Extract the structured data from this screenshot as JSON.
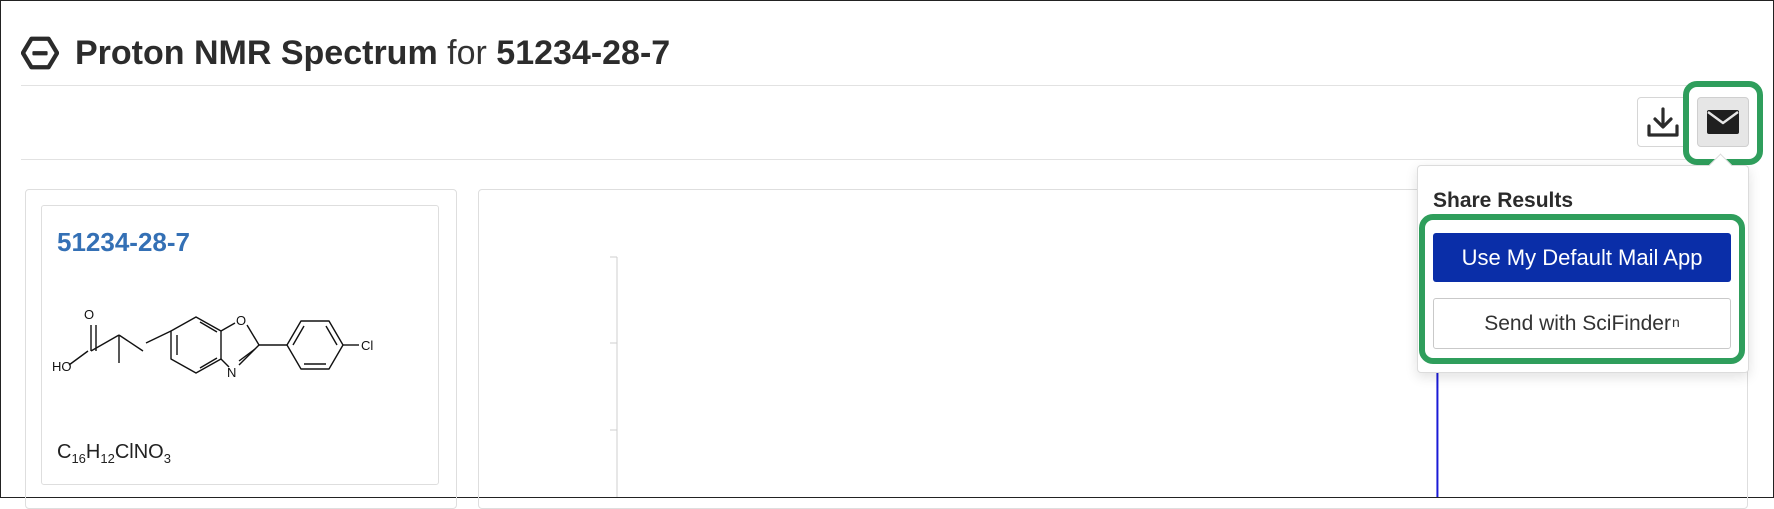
{
  "header": {
    "title_main": "Proton NMR Spectrum",
    "title_for": "for",
    "title_cas": "51234-28-7"
  },
  "toolbar": {
    "download_icon": "download-icon",
    "mail_icon": "envelope-icon"
  },
  "substance": {
    "cas_number": "51234-28-7",
    "formula_c": "C",
    "formula_c_count": "16",
    "formula_h": "H",
    "formula_h_count": "12",
    "formula_rest": "ClNO",
    "formula_o_count": "3",
    "structure_labels": {
      "oxygen_carbonyl": "O",
      "hydroxyl": "HO",
      "ring_oxygen": "O",
      "ring_nitrogen": "N",
      "chlorine": "Cl"
    }
  },
  "share_popover": {
    "title": "Share Results",
    "default_mail_label": "Use My Default Mail App",
    "scifinder_label": "Send with SciFinder",
    "scifinder_superscript": "n"
  },
  "colors": {
    "primary_button": "#0a2ea8",
    "link": "#3470b5",
    "highlight": "#2f9e5c",
    "spectrum_line": "#1a1ad6"
  },
  "spectrum": {
    "peaks": [
      {
        "position_fraction": 0.78,
        "intensity": 0.82
      }
    ]
  }
}
